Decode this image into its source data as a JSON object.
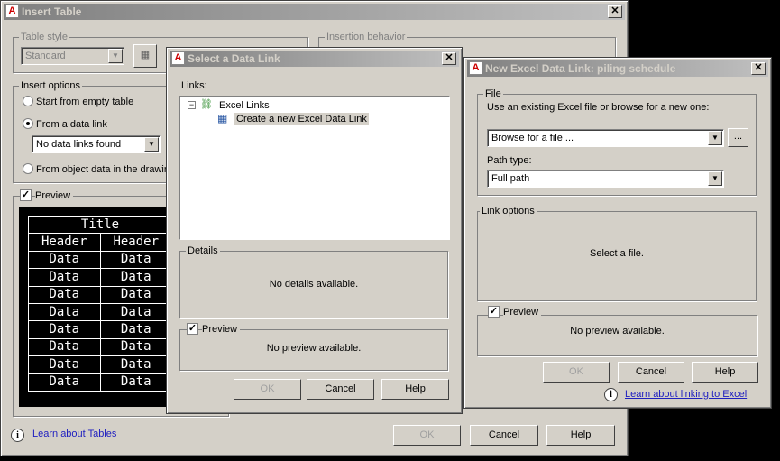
{
  "insert_table": {
    "title": "Insert Table",
    "table_style_label": "Table style",
    "table_style_value": "Standard",
    "insertion_behavior_label": "Insertion behavior",
    "insert_options_label": "Insert options",
    "opt_empty": "Start from empty table",
    "opt_data_link": "From a data link",
    "data_link_value": "No data links found",
    "opt_object": "From object data in the drawing",
    "preview_label": "Preview",
    "preview_title": "Title",
    "preview_header": "Header",
    "preview_data": "Data",
    "learn": "Learn about Tables",
    "ok": "OK",
    "cancel": "Cancel",
    "help": "Help"
  },
  "select_link": {
    "title": "Select a Data Link",
    "links_label": "Links:",
    "tree_root": "Excel Links",
    "tree_child": "Create a new Excel Data Link",
    "details_label": "Details",
    "details_text": "No details available.",
    "preview_label": "Preview",
    "preview_text": "No preview available.",
    "ok": "OK",
    "cancel": "Cancel",
    "help": "Help"
  },
  "new_link": {
    "title": "New Excel Data Link: piling schedule",
    "file_label": "File",
    "file_prompt": "Use an existing Excel file or browse for a new one:",
    "file_value": "Browse for a file ...",
    "browse": "...",
    "path_label": "Path type:",
    "path_value": "Full path",
    "link_options_label": "Link options",
    "link_options_text": "Select a file.",
    "preview_label": "Preview",
    "preview_text": "No preview available.",
    "ok": "OK",
    "cancel": "Cancel",
    "help": "Help",
    "learn": "Learn about linking to Excel"
  }
}
